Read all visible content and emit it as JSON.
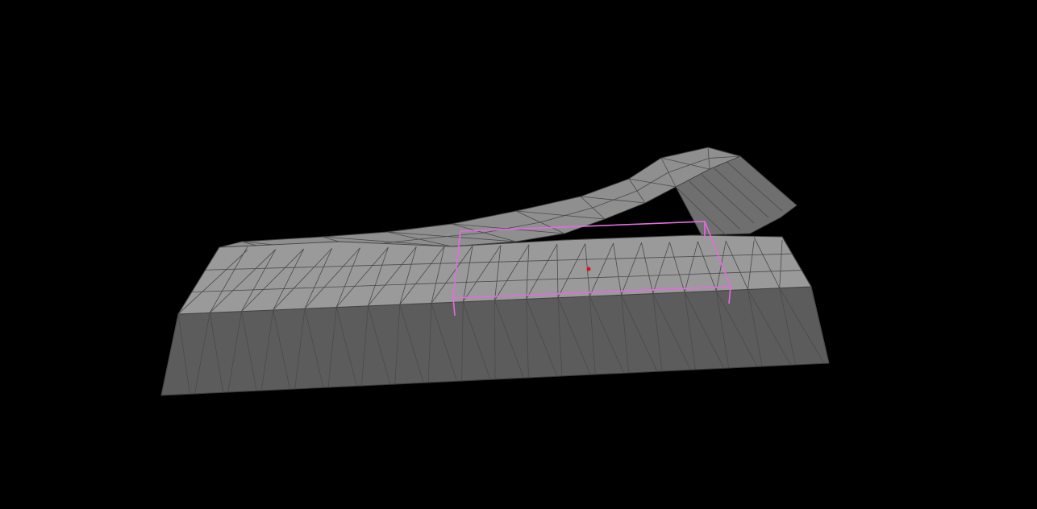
{
  "scene": {
    "background_color": "#000000",
    "mesh_top_color": "#9a9a9a",
    "mesh_front_color": "#5c5c5c",
    "wire_color": "#3a3a3a",
    "selection_color": "#e46be0",
    "pivot_color": "#e01010"
  }
}
